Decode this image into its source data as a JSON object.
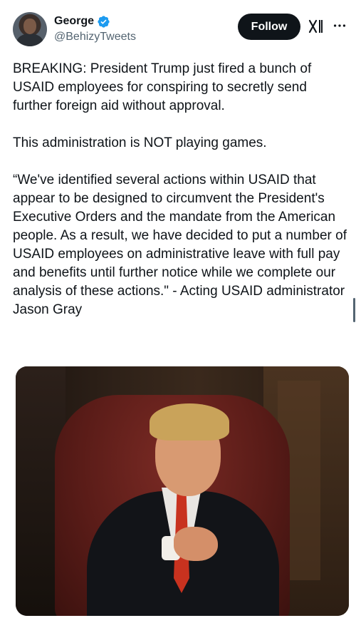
{
  "author": {
    "display_name": "George",
    "handle": "@BehizyTweets",
    "verified": true,
    "verified_color": "#1d9bf0"
  },
  "actions": {
    "follow_label": "Follow",
    "grok_icon": "grok-icon",
    "more_icon": "more-icon"
  },
  "tweet": {
    "text": "BREAKING: President Trump just fired a bunch of USAID employees for conspiring to secretly send further foreign aid without approval.\n\nThis administration is NOT playing games.\n\n“We've identified several actions within USAID that appear to be designed to circumvent the President's Executive Orders and the mandate from the American people. As a result, we have decided to put a number of USAID employees on administrative leave with full pay and benefits until further notice while we complete our analysis of these actions.\" - Acting USAID administrator Jason Gray"
  },
  "colors": {
    "text_primary": "#0f1419",
    "text_secondary": "#536471",
    "follow_bg": "#0f1419"
  }
}
